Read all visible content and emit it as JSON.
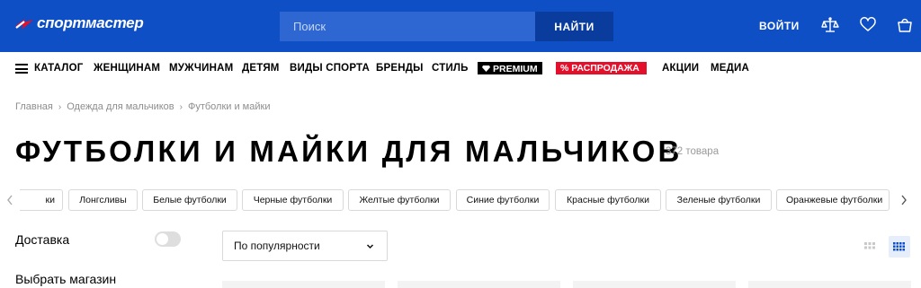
{
  "header": {
    "logo_text": "спортмастер",
    "search_placeholder": "Поиск",
    "search_button": "НАЙТИ",
    "login": "ВОЙТИ",
    "brand_color": "#0f4fc5",
    "icons": [
      "compare-icon",
      "heart-icon",
      "cart-icon"
    ]
  },
  "nav": {
    "items": [
      "КАТАЛОГ",
      "ЖЕНЩИНАМ",
      "МУЖЧИНАМ",
      "ДЕТЯМ",
      "ВИДЫ СПОРТА",
      "БРЕНДЫ",
      "СТИЛЬ"
    ],
    "premium": "PREMIUM",
    "sale": "% РАСПРОДАЖА",
    "sale_color": "#e40f2a",
    "extra": [
      "АКЦИИ",
      "МЕДИА"
    ]
  },
  "breadcrumb": [
    "Главная",
    "Одежда для мальчиков",
    "Футболки и майки"
  ],
  "title": "ФУТБОЛКИ И МАЙКИ ДЛЯ МАЛЬЧИКОВ",
  "count": "372 товара",
  "tags": {
    "partial": "ки",
    "items": [
      "Лонгсливы",
      "Белые футболки",
      "Черные футболки",
      "Желтые футболки",
      "Синие футболки",
      "Красные футболки",
      "Зеленые футболки",
      "Оранжевые футболки"
    ]
  },
  "filters": {
    "delivery": "Доставка",
    "store": "Выбрать магазин"
  },
  "sort": {
    "selected": "По популярности"
  }
}
